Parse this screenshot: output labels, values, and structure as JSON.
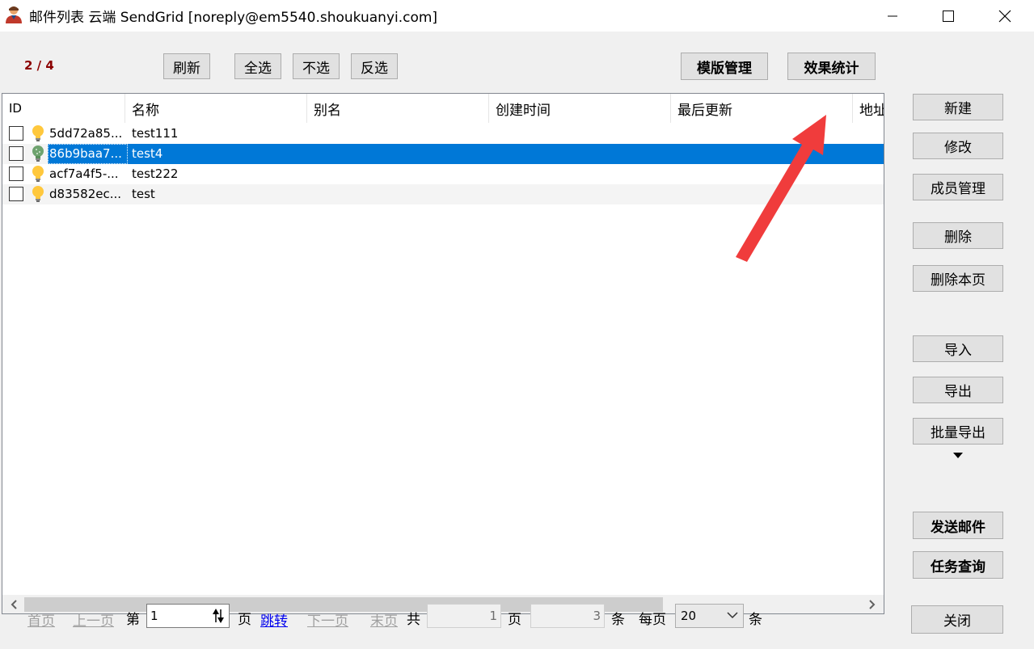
{
  "window": {
    "title": "邮件列表 云端 SendGrid [noreply@em5540.shoukuanyi.com]",
    "minimize_icon": "minimize-icon",
    "maximize_icon": "maximize-icon",
    "close_icon": "close-icon"
  },
  "toolbar": {
    "page_count": "2 / 4",
    "refresh": "刷新",
    "select_all": "全选",
    "select_none": "不选",
    "invert": "反选",
    "template_mgmt": "模版管理",
    "stats": "效果统计"
  },
  "table": {
    "columns": [
      "ID",
      "名称",
      "别名",
      "创建时间",
      "最后更新",
      "地址"
    ],
    "rows": [
      {
        "id": "5dd72a85...",
        "name": "test111",
        "checked": false,
        "selected": false,
        "icon": "bulb-yellow-icon"
      },
      {
        "id": "86b9baa7...",
        "name": "test4",
        "checked": false,
        "selected": true,
        "icon": "bulb-green-icon"
      },
      {
        "id": "acf7a4f5-...",
        "name": "test222",
        "checked": false,
        "selected": false,
        "icon": "bulb-yellow-icon"
      },
      {
        "id": "d83582ec...",
        "name": "test",
        "checked": false,
        "selected": false,
        "icon": "bulb-yellow-icon"
      }
    ]
  },
  "sidebar": {
    "new": "新建",
    "edit": "修改",
    "members": "成员管理",
    "delete": "删除",
    "delete_page": "删除本页",
    "import": "导入",
    "export": "导出",
    "batch_export": "批量导出",
    "send_mail": "发送邮件",
    "task_query": "任务查询",
    "close": "关闭"
  },
  "pager": {
    "first": "首页",
    "prev": "上一页",
    "page_label": "第",
    "page_value": "1",
    "page_suffix": "页",
    "jump": "跳转",
    "next": "下一页",
    "last": "末页",
    "total_label": "共",
    "total_pages": "1",
    "pages_suffix": "页",
    "total_items": "3",
    "items_suffix": "条",
    "per_page_label": "每页",
    "per_page_value": "20",
    "per_page_suffix": "条"
  },
  "colors": {
    "selection": "#0078d7",
    "page_count": "#8b0000",
    "link": "#0000ee",
    "annotation_arrow": "#f03c3c"
  }
}
